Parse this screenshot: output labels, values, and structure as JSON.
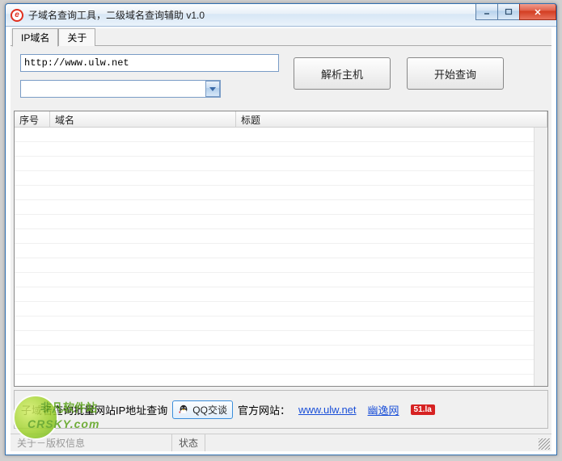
{
  "window": {
    "title": "子域名查询工具，二级域名查询辅助 v1.0"
  },
  "tabs": {
    "items": [
      {
        "label": "IP域名",
        "active": true
      },
      {
        "label": "关于",
        "active": false
      }
    ]
  },
  "inputs": {
    "url_value": "http://www.ulw.net",
    "combo_value": ""
  },
  "buttons": {
    "resolve": "解析主机",
    "start": "开始查询"
  },
  "table": {
    "columns": [
      "序号",
      "域名",
      "标题"
    ]
  },
  "footer": {
    "desc": "子域名查询批量网站IP地址查询",
    "qq_label": "QQ交谈",
    "official_prefix": "官方网站：",
    "link1": "www.ulw.net",
    "link2": "幽逸网",
    "badge": "51.la"
  },
  "statusbar": {
    "left": "关于－版权信息",
    "state_label": "状态"
  },
  "watermark": {
    "line1": "非凡软件站",
    "line2": "CRSKY.com"
  }
}
